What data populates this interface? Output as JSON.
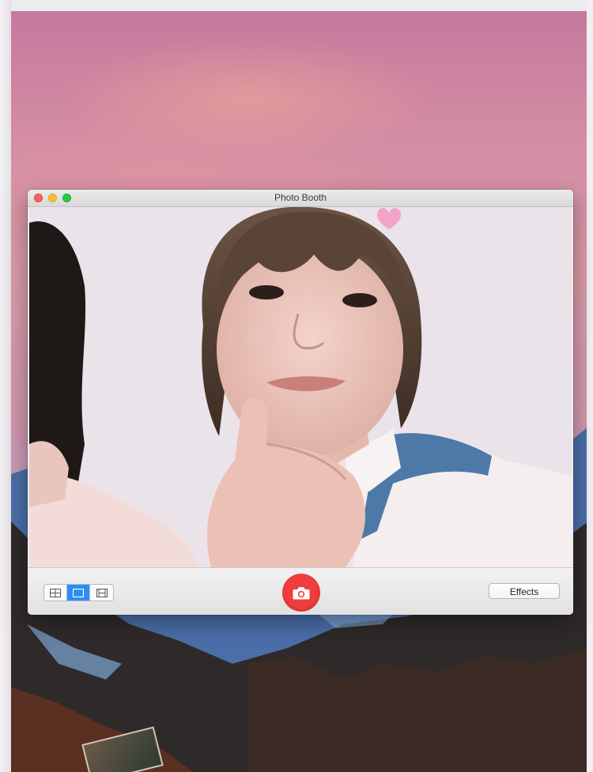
{
  "window": {
    "title": "Photo Booth"
  },
  "toolbar": {
    "layouts": [
      {
        "name": "four-up",
        "icon": "grid-2x2-icon"
      },
      {
        "name": "single",
        "icon": "single-frame-icon",
        "selected": true
      },
      {
        "name": "video",
        "icon": "filmstrip-icon"
      }
    ],
    "shutter_icon": "camera-icon",
    "effects_label": "Effects"
  },
  "colors": {
    "shutter": "#ef3c3c",
    "selected_layout": "#2d8ef5"
  }
}
